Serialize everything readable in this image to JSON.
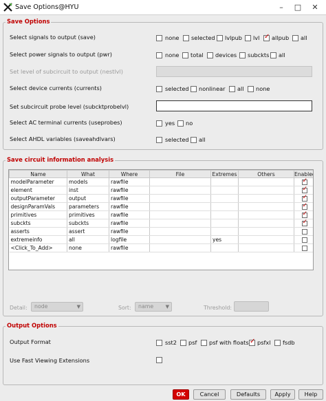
{
  "window": {
    "title": "Save Options@HYU",
    "minimize": "–",
    "maximize": "□",
    "close": "✕"
  },
  "save_options": {
    "title": "Save Options",
    "rows": {
      "save": {
        "label": "Select signals to output (save)",
        "options": [
          {
            "label": "none",
            "checked": false
          },
          {
            "label": "selected",
            "checked": false
          },
          {
            "label": "lvlpub",
            "checked": false
          },
          {
            "label": "lvl",
            "checked": false
          },
          {
            "label": "allpub",
            "checked": true
          },
          {
            "label": "all",
            "checked": false
          }
        ]
      },
      "pwr": {
        "label": "Select power signals to output (pwr)",
        "options": [
          {
            "label": "none",
            "checked": false
          },
          {
            "label": "total",
            "checked": false
          },
          {
            "label": "devices",
            "checked": false
          },
          {
            "label": "subckts",
            "checked": false
          },
          {
            "label": "all",
            "checked": false
          }
        ]
      },
      "nestlvl": {
        "label": "Set level of subcircuit to output (nestlvl)",
        "value": ""
      },
      "currents": {
        "label": "Select device currents (currents)",
        "options": [
          {
            "label": "selected",
            "checked": false
          },
          {
            "label": "nonlinear",
            "checked": false
          },
          {
            "label": "all",
            "checked": false
          },
          {
            "label": "none",
            "checked": false
          }
        ]
      },
      "subcktprobelvl": {
        "label": "Set subcircuit probe level (subcktprobelvl)",
        "value": ""
      },
      "useprobes": {
        "label": "Select AC terminal currents (useprobes)",
        "options": [
          {
            "label": "yes",
            "checked": false
          },
          {
            "label": "no",
            "checked": false
          }
        ]
      },
      "saveahdlvars": {
        "label": "Select AHDL variables (saveahdlvars)",
        "options": [
          {
            "label": "selected",
            "checked": false
          },
          {
            "label": "all",
            "checked": false
          }
        ]
      }
    }
  },
  "circuit_info": {
    "title": "Save circuit information analysis",
    "columns": [
      "Name",
      "What",
      "Where",
      "File",
      "Extremes",
      "Others",
      "Enabled"
    ],
    "rows": [
      {
        "name": "modelParameter",
        "what": "models",
        "where": "rawfile",
        "file": "",
        "extremes": "",
        "others": "",
        "enabled": true
      },
      {
        "name": "element",
        "what": "inst",
        "where": "rawfile",
        "file": "",
        "extremes": "",
        "others": "",
        "enabled": true
      },
      {
        "name": "outputParameter",
        "what": "output",
        "where": "rawfile",
        "file": "",
        "extremes": "",
        "others": "",
        "enabled": true
      },
      {
        "name": "designParamVals",
        "what": "parameters",
        "where": "rawfile",
        "file": "",
        "extremes": "",
        "others": "",
        "enabled": true
      },
      {
        "name": "primitives",
        "what": "primitives",
        "where": "rawfile",
        "file": "",
        "extremes": "",
        "others": "",
        "enabled": true
      },
      {
        "name": "subckts",
        "what": "subckts",
        "where": "rawfile",
        "file": "",
        "extremes": "",
        "others": "",
        "enabled": true
      },
      {
        "name": "asserts",
        "what": "assert",
        "where": "rawfile",
        "file": "",
        "extremes": "",
        "others": "",
        "enabled": false
      },
      {
        "name": "extremeinfo",
        "what": "all",
        "where": "logfile",
        "file": "",
        "extremes": "yes",
        "others": "",
        "enabled": false
      },
      {
        "name": "<Click_To_Add>",
        "what": "none",
        "where": "rawfile",
        "file": "",
        "extremes": "",
        "others": "",
        "enabled": false
      }
    ],
    "detail_label": "Detail:",
    "detail_value": "node",
    "sort_label": "Sort:",
    "sort_value": "name",
    "threshold_label": "Threshold:"
  },
  "output_options": {
    "title": "Output Options",
    "format_label": "Output Format",
    "formats": [
      {
        "label": "sst2",
        "checked": false
      },
      {
        "label": "psf",
        "checked": false
      },
      {
        "label": "psf with floats",
        "checked": false
      },
      {
        "label": "psfxl",
        "checked": true
      },
      {
        "label": "fsdb",
        "checked": false
      }
    ],
    "fast_label": "Use Fast Viewing Extensions",
    "fast_checked": false
  },
  "buttons": {
    "ok": "OK",
    "cancel": "Cancel",
    "defaults": "Defaults",
    "apply": "Apply",
    "help": "Help"
  },
  "colors": {
    "accent": "#c00000",
    "ok_bg": "#d30000",
    "check": "#c40000"
  }
}
